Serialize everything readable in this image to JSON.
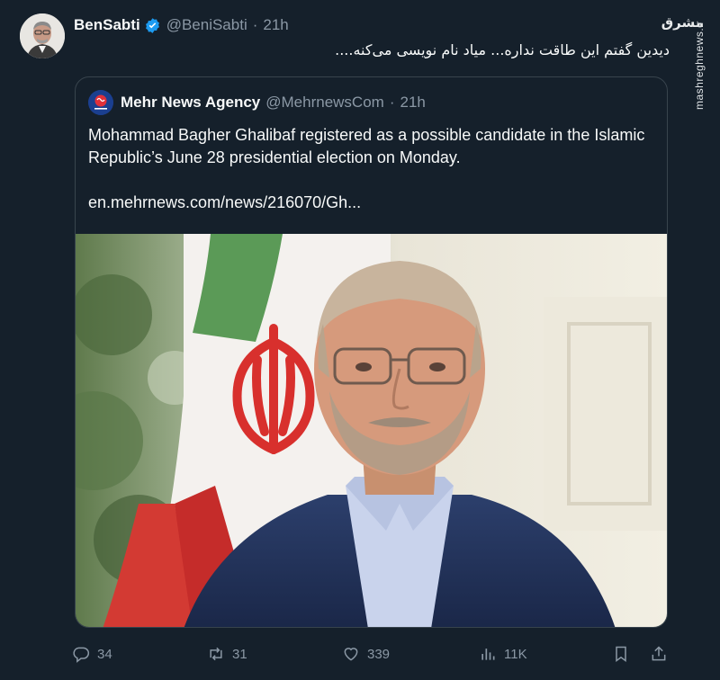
{
  "author": {
    "display_name": "BenSabti",
    "handle": "@BeniSabti",
    "separator": "·",
    "time": "21h",
    "text": "دیدین گفتم این طاقت نداره... میاد نام نویسی می‌کنه...."
  },
  "watermark": {
    "logo": "مشرق",
    "url": "mashreghnews.ir"
  },
  "quoted": {
    "display_name": "Mehr News Agency",
    "handle": "@MehrnewsCom",
    "separator": "·",
    "time": "21h",
    "text": "Mohammad Bagher Ghalibaf registered as a possible candidate in the Islamic Republic’s June 28 presidential election on Monday.",
    "link": "en.mehrnews.com/news/216070/Gh..."
  },
  "actions": {
    "replies": "34",
    "reposts": "31",
    "likes": "339",
    "views": "11K"
  },
  "colors": {
    "background": "#15202b",
    "verified": "#1d9bf0",
    "muted": "#8b98a5",
    "border": "#38444d"
  }
}
